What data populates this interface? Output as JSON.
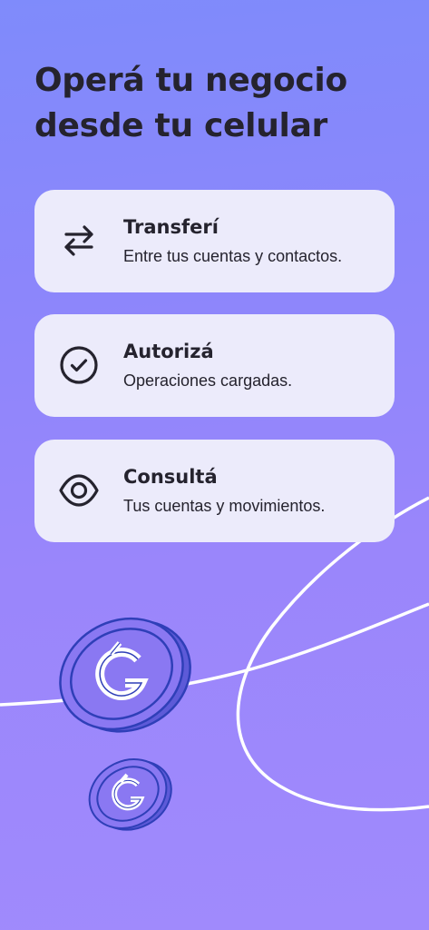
{
  "header": {
    "title_line1": "Operá tu negocio",
    "title_line2": "desde tu celular"
  },
  "features": [
    {
      "icon": "transfer-arrows-icon",
      "title": "Transferí",
      "description": "Entre tus cuentas y contactos."
    },
    {
      "icon": "check-circle-icon",
      "title": "Autorizá",
      "description": "Operaciones cargadas."
    },
    {
      "icon": "eye-icon",
      "title": "Consultá",
      "description": "Tus cuentas y movimientos."
    }
  ],
  "colors": {
    "background_top": "#7f8bfb",
    "background_bottom": "#a08afc",
    "card_background": "#ecebfb",
    "text": "#25232e",
    "coin_blue": "#2f3fb8",
    "coin_fill": "#8a78f2"
  }
}
